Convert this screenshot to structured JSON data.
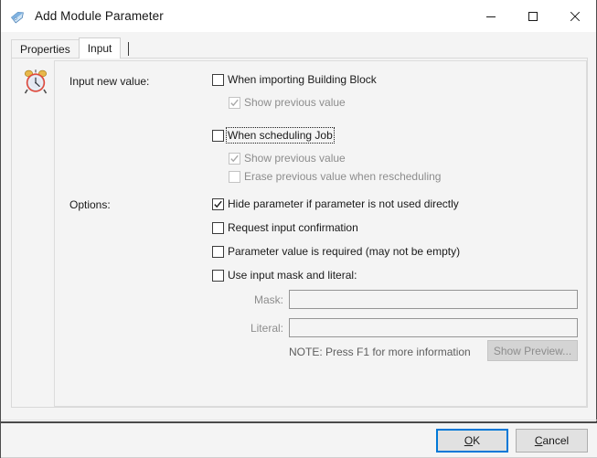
{
  "window": {
    "title": "Add Module Parameter",
    "icon": "tag-icon",
    "controls": {
      "minimize": "minimize-icon",
      "maximize": "maximize-icon",
      "close": "close-icon"
    }
  },
  "tabs": [
    {
      "label": "Properties",
      "selected": false
    },
    {
      "label": "Input",
      "selected": true
    }
  ],
  "panel": {
    "icon": "alarm-clock-icon"
  },
  "input_new_value": {
    "label": "Input new value:",
    "options": [
      {
        "label": "When importing Building Block",
        "checked": false,
        "disabled": false,
        "focused": false,
        "indent": 0
      },
      {
        "label": "Show previous value",
        "checked": true,
        "disabled": true,
        "focused": false,
        "indent": 1
      },
      {
        "label": "When scheduling Job",
        "checked": false,
        "disabled": false,
        "focused": true,
        "indent": 0
      },
      {
        "label": "Show previous value",
        "checked": true,
        "disabled": true,
        "focused": false,
        "indent": 1
      },
      {
        "label": "Erase previous value when rescheduling",
        "checked": false,
        "disabled": true,
        "focused": false,
        "indent": 1
      }
    ]
  },
  "options": {
    "label": "Options:",
    "items": [
      {
        "label": "Hide parameter if parameter is not used directly",
        "checked": true,
        "disabled": false
      },
      {
        "label": "Request input confirmation",
        "checked": false,
        "disabled": false
      },
      {
        "label": "Parameter value is required (may not be empty)",
        "checked": false,
        "disabled": false
      },
      {
        "label": "Use input mask and literal:",
        "checked": false,
        "disabled": false
      }
    ]
  },
  "mask_field": {
    "label": "Mask:",
    "value": "",
    "placeholder": "",
    "disabled": true
  },
  "literal_field": {
    "label": "Literal:",
    "value": "",
    "placeholder": "",
    "disabled": true
  },
  "note": "NOTE: Press F1 for more information",
  "preview_button": {
    "label": "Show Preview...",
    "disabled": true
  },
  "footer": {
    "ok_label": "OK",
    "ok_accel": "O",
    "cancel_label": "Cancel",
    "cancel_accel": "C"
  },
  "colors": {
    "accent": "#0078d7",
    "window_bg": "#f4f4f4",
    "titlebar_bg": "#ffffff",
    "text": "#1a1a1a",
    "disabled_text": "#8d8d8d"
  }
}
